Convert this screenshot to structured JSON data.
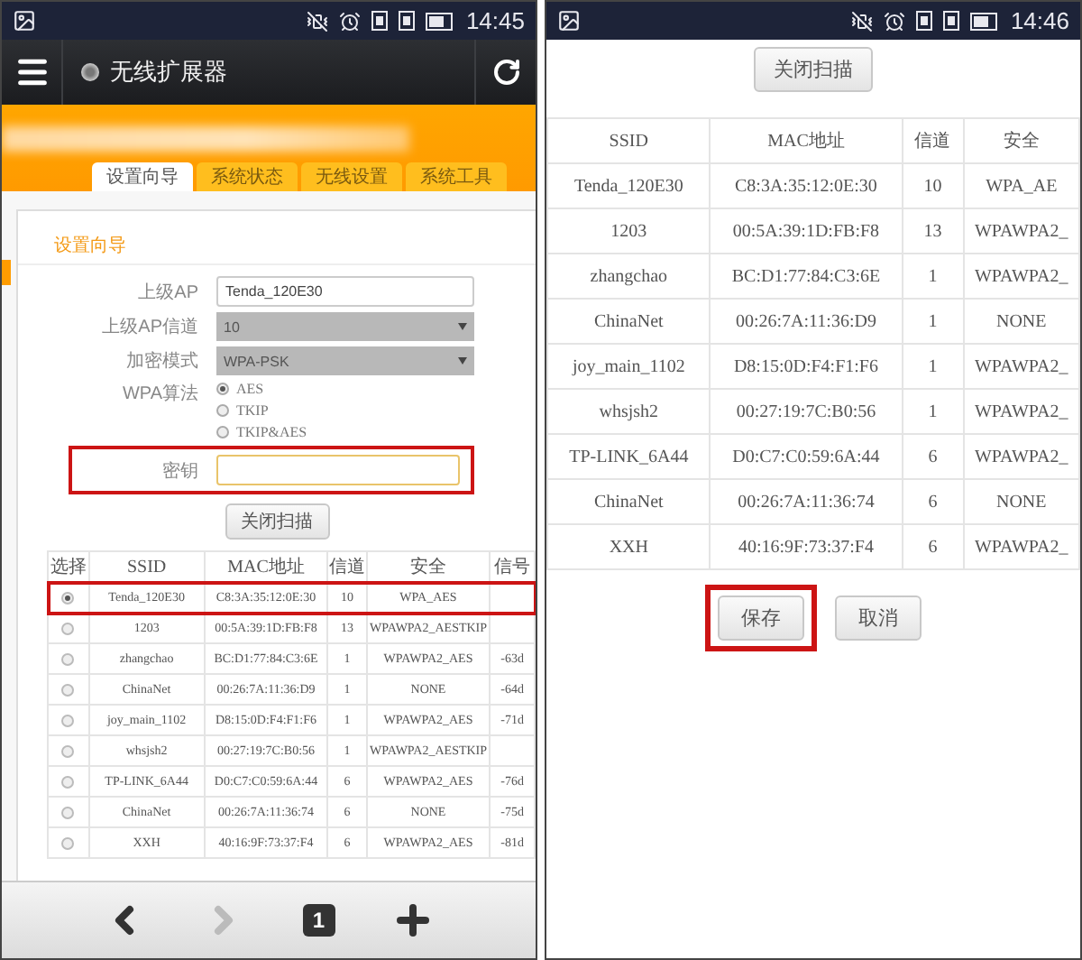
{
  "left": {
    "status_bar": {
      "time": "14:45"
    },
    "app_bar": {
      "title": "无线扩展器"
    },
    "tabs": [
      {
        "label": "设置向导",
        "selected": true
      },
      {
        "label": "系统状态",
        "selected": false
      },
      {
        "label": "无线设置",
        "selected": false
      },
      {
        "label": "系统工具",
        "selected": false
      }
    ],
    "section_title": "设置向导",
    "form": [
      {
        "kind": "text",
        "label": "上级AP",
        "value": "Tenda_120E30",
        "highlighted": false
      },
      {
        "kind": "select",
        "label": "上级AP信道",
        "value": "10",
        "highlighted": false
      },
      {
        "kind": "select",
        "label": "加密模式",
        "value": "WPA-PSK",
        "highlighted": false
      },
      {
        "kind": "radio",
        "label": "WPA算法",
        "highlighted": false,
        "options": [
          {
            "label": "AES",
            "selected": true
          },
          {
            "label": "TKIP",
            "selected": false
          },
          {
            "label": "TKIP&AES",
            "selected": false
          }
        ]
      },
      {
        "kind": "text",
        "label": "密钥",
        "highlighted": true
      }
    ],
    "scan_button": "关闭扫描",
    "table": {
      "columns": [
        "选择",
        "SSID",
        "MAC地址",
        "信道",
        "安全",
        "信号"
      ],
      "rows": [
        {
          "selected": true,
          "highlighted": true,
          "ssid": "Tenda_120E30",
          "mac": "C8:3A:35:12:0E:30",
          "channel": "10",
          "security": "WPA_AES"
        },
        {
          "selected": false,
          "highlighted": false,
          "ssid": "1203",
          "mac": "00:5A:39:1D:FB:F8",
          "channel": "13",
          "security": "WPAWPA2_AESTKIP"
        },
        {
          "selected": false,
          "highlighted": false,
          "ssid": "zhangchao",
          "mac": "BC:D1:77:84:C3:6E",
          "channel": "1",
          "security": "WPAWPA2_AES",
          "signal": "-63d"
        },
        {
          "selected": false,
          "highlighted": false,
          "ssid": "ChinaNet",
          "mac": "00:26:7A:11:36:D9",
          "channel": "1",
          "security": "NONE",
          "signal": "-64d"
        },
        {
          "selected": false,
          "highlighted": false,
          "ssid": "joy_main_1102",
          "mac": "D8:15:0D:F4:F1:F6",
          "channel": "1",
          "security": "WPAWPA2_AES",
          "signal": "-71d"
        },
        {
          "selected": false,
          "highlighted": false,
          "ssid": "whsjsh2",
          "mac": "00:27:19:7C:B0:56",
          "channel": "1",
          "security": "WPAWPA2_AESTKIP"
        },
        {
          "selected": false,
          "highlighted": false,
          "ssid": "TP-LINK_6A44",
          "mac": "D0:C7:C0:59:6A:44",
          "channel": "6",
          "security": "WPAWPA2_AES",
          "signal": "-76d"
        },
        {
          "selected": false,
          "highlighted": false,
          "ssid": "ChinaNet",
          "mac": "00:26:7A:11:36:74",
          "channel": "6",
          "security": "NONE",
          "signal": "-75d"
        },
        {
          "selected": false,
          "highlighted": false,
          "ssid": "XXH",
          "mac": "40:16:9F:73:37:F4",
          "channel": "6",
          "security": "WPAWPA2_AES",
          "signal": "-81d"
        }
      ]
    },
    "bottom_nav": {
      "page": "1",
      "forward_disabled": true
    }
  },
  "right": {
    "status_bar": {
      "time": "14:46"
    },
    "scan_button": "关闭扫描",
    "table": {
      "columns": [
        "SSID",
        "MAC地址",
        "信道",
        "安全"
      ],
      "rows": [
        {
          "ssid": "Tenda_120E30",
          "mac": "C8:3A:35:12:0E:30",
          "channel": "10",
          "security": "WPA_AE"
        },
        {
          "ssid": "1203",
          "mac": "00:5A:39:1D:FB:F8",
          "channel": "13",
          "security": "WPAWPA2_"
        },
        {
          "ssid": "zhangchao",
          "mac": "BC:D1:77:84:C3:6E",
          "channel": "1",
          "security": "WPAWPA2_"
        },
        {
          "ssid": "ChinaNet",
          "mac": "00:26:7A:11:36:D9",
          "channel": "1",
          "security": "NONE"
        },
        {
          "ssid": "joy_main_1102",
          "mac": "D8:15:0D:F4:F1:F6",
          "channel": "1",
          "security": "WPAWPA2_"
        },
        {
          "ssid": "whsjsh2",
          "mac": "00:27:19:7C:B0:56",
          "channel": "1",
          "security": "WPAWPA2_"
        },
        {
          "ssid": "TP-LINK_6A44",
          "mac": "D0:C7:C0:59:6A:44",
          "channel": "6",
          "security": "WPAWPA2_"
        },
        {
          "ssid": "ChinaNet",
          "mac": "00:26:7A:11:36:74",
          "channel": "6",
          "security": "NONE"
        },
        {
          "ssid": "XXH",
          "mac": "40:16:9F:73:37:F4",
          "channel": "6",
          "security": "WPAWPA2_"
        }
      ]
    },
    "buttons": [
      {
        "label": "保存",
        "highlighted": true
      },
      {
        "label": "取消",
        "highlighted": false
      }
    ]
  }
}
